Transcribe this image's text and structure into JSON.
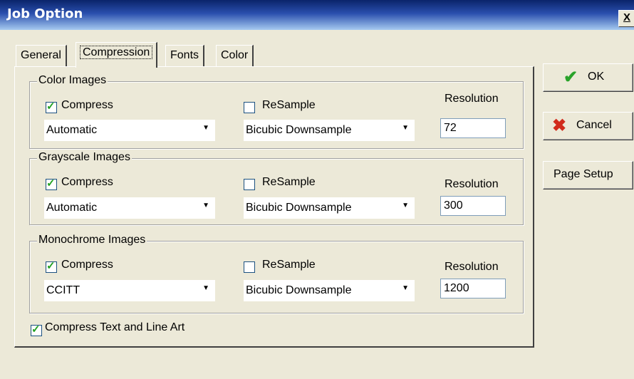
{
  "window": {
    "title": "Job Option",
    "close_label": "X"
  },
  "tabs": [
    "General",
    "Compression",
    "Fonts",
    "Color"
  ],
  "active_tab": "Compression",
  "groups": {
    "color": {
      "title": "Color Images",
      "compress_label": "Compress",
      "compress_checked": true,
      "resample_label": "ReSample",
      "resample_checked": false,
      "method": "Automatic",
      "downsample": "Bicubic Downsample",
      "resolution_label": "Resolution",
      "resolution": "72"
    },
    "grayscale": {
      "title": "Grayscale Images",
      "compress_label": "Compress",
      "compress_checked": true,
      "resample_label": "ReSample",
      "resample_checked": false,
      "method": "Automatic",
      "downsample": "Bicubic Downsample",
      "resolution_label": "Resolution",
      "resolution": "300"
    },
    "monochrome": {
      "title": "Monochrome Images",
      "compress_label": "Compress",
      "compress_checked": true,
      "resample_label": "ReSample",
      "resample_checked": false,
      "method": "CCITT",
      "downsample": "Bicubic Downsample",
      "resolution_label": "Resolution",
      "resolution": "1200"
    }
  },
  "compress_text": {
    "label": "Compress Text and Line Art",
    "checked": true
  },
  "buttons": {
    "ok": "OK",
    "cancel": "Cancel",
    "page_setup": "Page Setup"
  },
  "icons": {
    "check": "check-mark-icon",
    "ok": "green-check-icon",
    "cancel": "red-x-icon",
    "dropdown": "triangle-down-icon"
  },
  "colors": {
    "title_bar": "#0a246a",
    "ok_icon": "#2aa32a",
    "cancel_icon": "#d12b1c",
    "face": "#ece9d8"
  }
}
